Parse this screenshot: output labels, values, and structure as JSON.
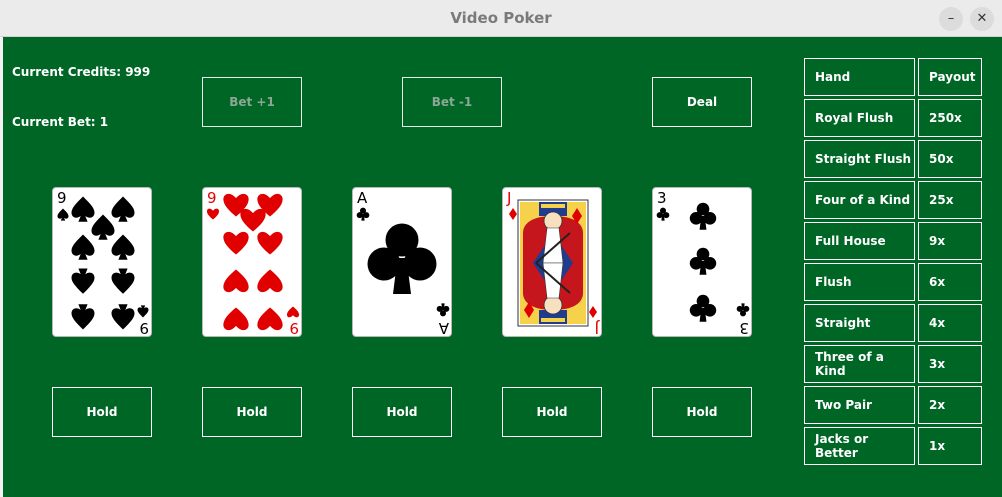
{
  "window": {
    "title": "Video Poker",
    "minimize_glyph": "–",
    "close_glyph": "✕"
  },
  "status": {
    "credits_text": "Current Credits: 999",
    "bet_text": "Current Bet: 1"
  },
  "controls": {
    "bet_plus_label": "Bet +1",
    "bet_minus_label": "Bet -1",
    "deal_label": "Deal"
  },
  "cards": [
    {
      "rank": "9",
      "suit": "spades",
      "color": "#000000",
      "hold_label": "Hold"
    },
    {
      "rank": "9",
      "suit": "hearts",
      "color": "#e00000",
      "hold_label": "Hold"
    },
    {
      "rank": "A",
      "suit": "clubs",
      "color": "#000000",
      "hold_label": "Hold"
    },
    {
      "rank": "J",
      "suit": "diamonds",
      "color": "#e00000",
      "hold_label": "Hold"
    },
    {
      "rank": "3",
      "suit": "clubs",
      "color": "#000000",
      "hold_label": "Hold"
    }
  ],
  "paytable": {
    "header": {
      "hand": "Hand",
      "payout": "Payout"
    },
    "rows": [
      {
        "hand": "Royal Flush",
        "payout": "250x"
      },
      {
        "hand": "Straight Flush",
        "payout": "50x"
      },
      {
        "hand": "Four of a Kind",
        "payout": "25x"
      },
      {
        "hand": "Full House",
        "payout": "9x"
      },
      {
        "hand": "Flush",
        "payout": "6x"
      },
      {
        "hand": "Straight",
        "payout": "4x"
      },
      {
        "hand": "Three of a Kind",
        "payout": "3x"
      },
      {
        "hand": "Two Pair",
        "payout": "2x"
      },
      {
        "hand": "Jacks or Better",
        "payout": "1x"
      }
    ]
  },
  "colors": {
    "felt": "#006625",
    "text": "#ffffff",
    "red_suit": "#e00000",
    "black_suit": "#000000"
  }
}
